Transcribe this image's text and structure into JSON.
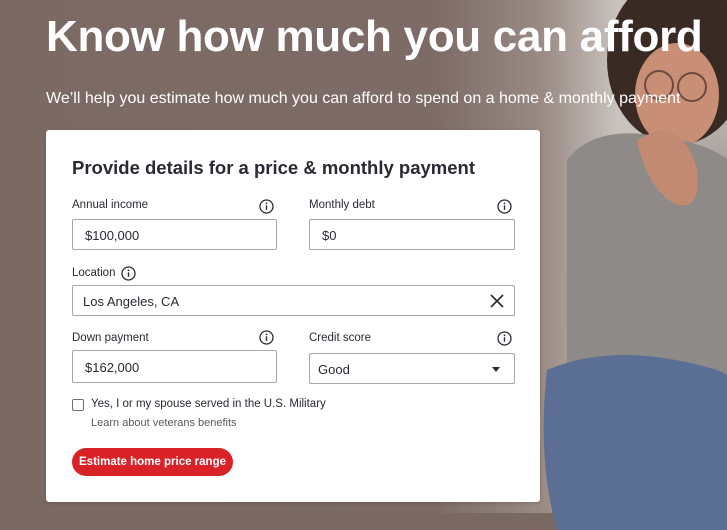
{
  "hero": {
    "title": "Know how much you can afford",
    "subtitle": "We’ll help you estimate how much you can afford to spend on a home & monthly payment"
  },
  "form": {
    "title": "Provide details for a price & monthly payment",
    "annual_income": {
      "label": "Annual income",
      "value": "$100,000"
    },
    "monthly_debt": {
      "label": "Monthly debt",
      "value": "$0"
    },
    "location": {
      "label": "Location",
      "value": "Los Angeles, CA"
    },
    "down_payment": {
      "label": "Down payment",
      "value": "$162,000"
    },
    "credit_score": {
      "label": "Credit score",
      "value": "Good"
    },
    "military": {
      "label": "Yes, I or my spouse served in the U.S. Military",
      "checked": false
    },
    "veterans_link": "Learn about veterans benefits",
    "submit_label": "Estimate home price range"
  },
  "colors": {
    "accent": "#d92228",
    "text": "#2a2a33",
    "border": "#a7a6ab",
    "background": "#7a6862"
  },
  "icons": {
    "info": "info-circle-icon",
    "clear": "close-icon",
    "dropdown": "caret-down-icon"
  }
}
